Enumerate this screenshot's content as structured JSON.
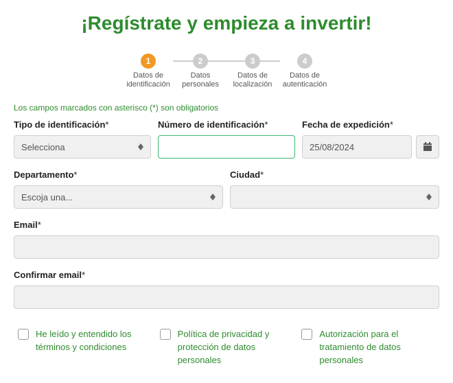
{
  "title": "¡Regístrate y empieza a invertir!",
  "stepper": {
    "steps": [
      {
        "num": "1",
        "line1": "Datos de",
        "line2": "identificación",
        "active": true
      },
      {
        "num": "2",
        "line1": "Datos",
        "line2": "personales",
        "active": false
      },
      {
        "num": "3",
        "line1": "Datos de",
        "line2": "localización",
        "active": false
      },
      {
        "num": "4",
        "line1": "Datos de",
        "line2": "autenticación",
        "active": false
      }
    ]
  },
  "required_note": "Los campos marcados con asterisco (*) son obligatorios",
  "fields": {
    "id_type": {
      "label": "Tipo de identificación",
      "ast": "*",
      "value": "Selecciona"
    },
    "id_number": {
      "label": "Número de identificación",
      "ast": "*",
      "value": ""
    },
    "issue_date": {
      "label": "Fecha de expedición",
      "ast": "*",
      "value": "25/08/2024"
    },
    "department": {
      "label": "Departamento",
      "ast": "*",
      "value": "Escoja una..."
    },
    "city": {
      "label": "Ciudad",
      "ast": "*",
      "value": ""
    },
    "email": {
      "label": "Email",
      "ast": "*",
      "value": ""
    },
    "confirm_email": {
      "label": "Confirmar email",
      "ast": "*",
      "value": ""
    }
  },
  "checks": {
    "c1": "He leído y entendido los términos y condiciones",
    "c2": "Política de privacidad y protección de datos personales",
    "c3": "Autorización para el tratamiento de datos personales"
  }
}
